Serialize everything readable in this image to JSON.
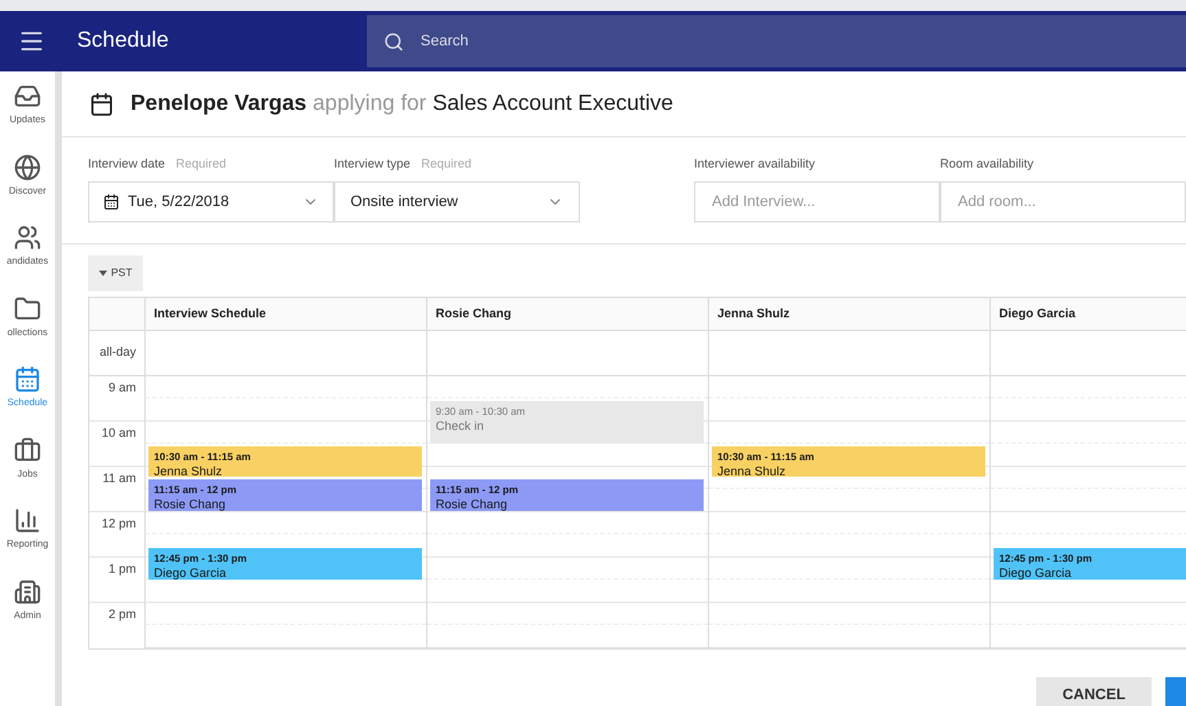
{
  "header": {
    "title": "Schedule",
    "search": {
      "placeholder": "Search"
    }
  },
  "sidebar": {
    "items": [
      {
        "label": "Updates",
        "selected": false
      },
      {
        "label": "Discover",
        "selected": false
      },
      {
        "label": "andidates",
        "selected": false
      },
      {
        "label": "ollections",
        "selected": false
      },
      {
        "label": "Schedule",
        "selected": true
      },
      {
        "label": "Jobs",
        "selected": false
      },
      {
        "label": "Reporting",
        "selected": false
      },
      {
        "label": "Admin",
        "selected": false
      }
    ]
  },
  "title": {
    "name": "Penelope Vargas",
    "connector": "applying for",
    "position": "Sales Account Executive"
  },
  "form": {
    "interview_date": {
      "label": "Interview date",
      "hint": "Required",
      "value": "Tue, 5/22/2018"
    },
    "interview_type": {
      "label": "Interview type",
      "hint": "Required",
      "value": "Onsite interview"
    },
    "interviewer_availability": {
      "label": "Interviewer availability",
      "placeholder": "Add Interview..."
    },
    "room_availability": {
      "label": "Room availability",
      "placeholder": "Add room..."
    }
  },
  "timezone": "PST",
  "calendar": {
    "all_day": "all-day",
    "hours": [
      "9 am",
      "10 am",
      "11 am",
      "12 pm",
      "1 pm",
      "2 pm"
    ],
    "columns": [
      {
        "title": "Interview Schedule",
        "events": [
          {
            "time": "10:30 am - 11:15 am",
            "name": "Jenna Shulz",
            "color": "#f9d162",
            "muted": false
          },
          {
            "time": "11:15 am - 12 pm",
            "name": "Rosie Chang",
            "color": "#8c9af5",
            "muted": false
          },
          {
            "time": "12:45 pm - 1:30 pm",
            "name": "Diego Garcia",
            "color": "#4fc3f7",
            "muted": false
          }
        ]
      },
      {
        "title": "Rosie Chang",
        "events": [
          {
            "time": "9:30 am - 10:30 am",
            "name": "Check in",
            "color": "#e8e8e8",
            "muted": true
          },
          {
            "time": "11:15 am - 12 pm",
            "name": "Rosie Chang",
            "color": "#8c9af5",
            "muted": false
          }
        ]
      },
      {
        "title": "Jenna Shulz",
        "events": [
          {
            "time": "10:30 am - 11:15 am",
            "name": "Jenna Shulz",
            "color": "#f9d162",
            "muted": false
          }
        ]
      },
      {
        "title": "Diego Garcia",
        "events": [
          {
            "time": "12:45 pm - 1:30 pm",
            "name": "Diego Garcia",
            "color": "#4fc3f7",
            "muted": false
          }
        ]
      }
    ]
  },
  "footer": {
    "cancel": "CANCEL"
  }
}
